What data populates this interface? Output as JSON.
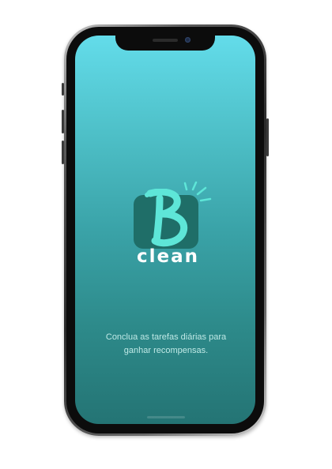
{
  "app": {
    "logo_mark": "B",
    "logo_word": "clean"
  },
  "splash": {
    "tagline_line1": "Conclua as tarefas diárias para",
    "tagline_line2": "ganhar recompensas."
  },
  "colors": {
    "screen_gradient_top": "#63dcea",
    "screen_gradient_bottom": "#247474",
    "logo_tile": "#1f6e68",
    "logo_accent": "#5ee6d8",
    "logo_word": "#ffffff",
    "tagline": "#bfe9e6"
  },
  "icons": {
    "logo": "bclean-logo-icon",
    "sparkle": "sparkle-rays-icon"
  }
}
